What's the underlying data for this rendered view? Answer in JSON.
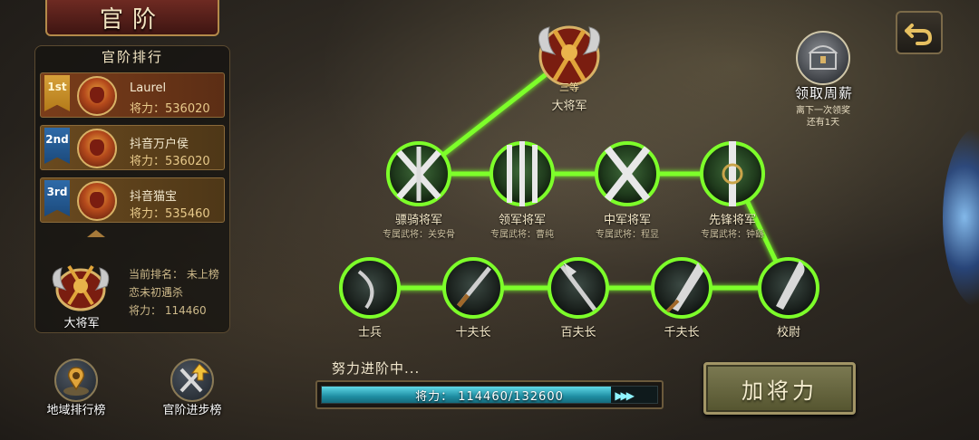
{
  "page_title": "官阶",
  "ranking": {
    "title": "官阶排行",
    "rows": [
      {
        "medal": "1st",
        "name": "Laurel",
        "power_label": "将力：",
        "power": "536020"
      },
      {
        "medal": "2nd",
        "name": "抖音万户侯",
        "power_label": "将力：",
        "power": "536020"
      },
      {
        "medal": "3rd",
        "name": "抖音猫宝",
        "power_label": "将力：",
        "power": "535460"
      }
    ]
  },
  "me": {
    "rank_label": "大将军",
    "current_rank": "当前排名：  未上榜",
    "name": "恋未初遇杀",
    "power": "将力：  114460"
  },
  "bottom_buttons": {
    "region": "地域排行榜",
    "progress": "官阶进步榜"
  },
  "tree": {
    "top": {
      "name": "大将军",
      "badge": "三等"
    },
    "generals": [
      {
        "name": "骠骑将军",
        "sub": "专属武将：关安骨"
      },
      {
        "name": "领军将军",
        "sub": "专属武将：曹纯"
      },
      {
        "name": "中军将军",
        "sub": "专属武将：程昱"
      },
      {
        "name": "先锋将军",
        "sub": "专属武将：钟繇"
      }
    ],
    "soldiers": [
      "士兵",
      "十夫长",
      "百夫长",
      "千夫长",
      "校尉"
    ]
  },
  "weekly": {
    "button": "领取周薪",
    "note_line1": "离下一次领奖",
    "note_line2": "还有1天"
  },
  "progress": {
    "status": "努力进阶中...",
    "text": "将力： 114460/132600",
    "value": 114460,
    "max": 132600
  },
  "add_power_label": "加将力",
  "colors": {
    "path": "#7dff2a",
    "accent_gold": "#d8b266",
    "progress": "#35b7c9"
  }
}
